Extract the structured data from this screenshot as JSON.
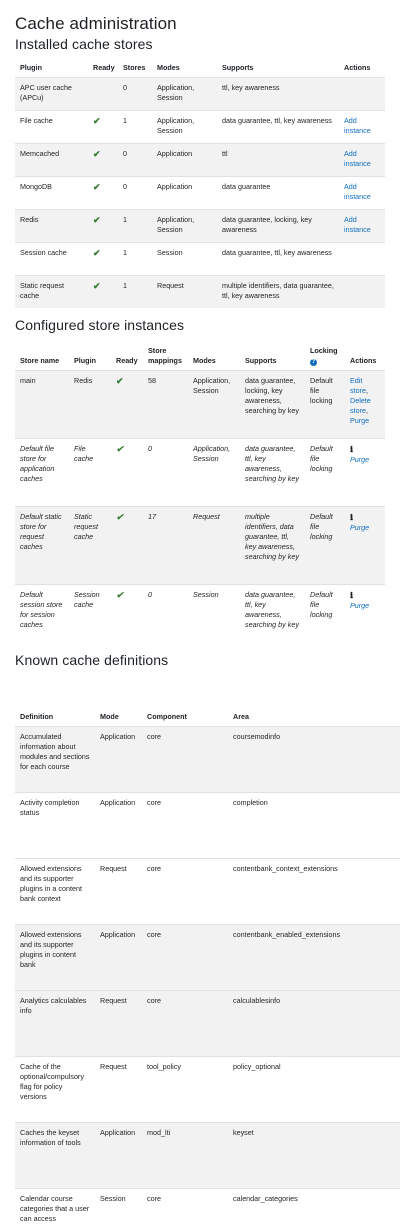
{
  "page": {
    "title": "Cache administration",
    "installed_heading": "Installed cache stores",
    "configured_heading": "Configured store instances",
    "definitions_heading": "Known cache definitions"
  },
  "installed": {
    "headers": [
      "Plugin",
      "Ready",
      "Stores",
      "Modes",
      "Supports",
      "Actions"
    ],
    "rows": [
      {
        "plugin": "APC user cache (APCu)",
        "ready": "",
        "stores": "0",
        "modes": "Application, Session",
        "supports": "ttl, key awareness",
        "action": ""
      },
      {
        "plugin": "File cache",
        "ready": "✔",
        "stores": "1",
        "modes": "Application, Session",
        "supports": "data guarantee, ttl, key awareness",
        "action": "Add instance"
      },
      {
        "plugin": "Memcached",
        "ready": "✔",
        "stores": "0",
        "modes": "Application",
        "supports": "ttl",
        "action": "Add instance"
      },
      {
        "plugin": "MongoDB",
        "ready": "✔",
        "stores": "0",
        "modes": "Application",
        "supports": "data guarantee",
        "action": "Add instance"
      },
      {
        "plugin": "Redis",
        "ready": "✔",
        "stores": "1",
        "modes": "Application, Session",
        "supports": "data guarantee, locking, key awareness",
        "action": "Add instance"
      },
      {
        "plugin": "Session cache",
        "ready": "✔",
        "stores": "1",
        "modes": "Session",
        "supports": "data guarantee, ttl, key awareness",
        "action": ""
      },
      {
        "plugin": "Static request cache",
        "ready": "✔",
        "stores": "1",
        "modes": "Request",
        "supports": "multiple identifiers, data guarantee, ttl, key awareness",
        "action": ""
      }
    ]
  },
  "configured": {
    "headers": [
      "Store name",
      "Plugin",
      "Ready",
      "Store mappings",
      "Modes",
      "Supports",
      "Locking",
      "Actions"
    ],
    "locking_icon": "question-icon",
    "rows": [
      {
        "name": "main",
        "plugin": "Redis",
        "ready": "✔",
        "mappings": "58",
        "modes": "Application, Session",
        "supports": "data guarantee, locking, key awareness, searching by key",
        "locking": "Default file locking",
        "actions": [
          "Edit store",
          "Delete store",
          "Purge"
        ]
      },
      {
        "name": "Default file store for application caches",
        "plugin": "File cache",
        "ready": "✔",
        "mappings": "0",
        "modes": "Application, Session",
        "supports": "data guarantee, ttl, key awareness, searching by key",
        "locking": "Default file locking",
        "info": "ℹ",
        "actions": [
          "Purge"
        ]
      },
      {
        "name": "Default static store for request caches",
        "plugin": "Static request cache",
        "ready": "✔",
        "mappings": "17",
        "modes": "Request",
        "supports": "multiple identifiers, data guarantee, ttl, key awareness, searching by key",
        "locking": "Default file locking",
        "info": "ℹ",
        "actions": [
          "Purge"
        ]
      },
      {
        "name": "Default session store for session caches",
        "plugin": "Session cache",
        "ready": "✔",
        "mappings": "0",
        "modes": "Session",
        "supports": "data guarantee, ttl, key awareness, searching by key",
        "locking": "Default file locking",
        "info": "ℹ",
        "actions": [
          "Purge"
        ]
      }
    ]
  },
  "definitions": {
    "headers": [
      "Definition",
      "Mode",
      "Component",
      "Area"
    ],
    "rows": [
      {
        "definition": "Accumulated information about modules and sections for each course",
        "mode": "Application",
        "component": "core",
        "area": "coursemodinfo"
      },
      {
        "definition": "Activity completion status",
        "mode": "Application",
        "component": "core",
        "area": "completion"
      },
      {
        "definition": "Allowed extensions and its supporter plugins in a content bank context",
        "mode": "Request",
        "component": "core",
        "area": "contentbank_context_extensions"
      },
      {
        "definition": "Allowed extensions and its supporter plugins in content bank",
        "mode": "Application",
        "component": "core",
        "area": "contentbank_enabled_extensions"
      },
      {
        "definition": "Analytics calculables info",
        "mode": "Request",
        "component": "core",
        "area": "calculablesinfo"
      },
      {
        "definition": "Cache of the optional/compulsory flag for policy versions",
        "mode": "Request",
        "component": "tool_policy",
        "area": "policy_optional"
      },
      {
        "definition": "Caches the keyset information of tools",
        "mode": "Application",
        "component": "mod_lti",
        "area": "keyset"
      },
      {
        "definition": "Calendar course categories that a user can access",
        "mode": "Session",
        "component": "core",
        "area": "calendar_categories"
      }
    ]
  }
}
